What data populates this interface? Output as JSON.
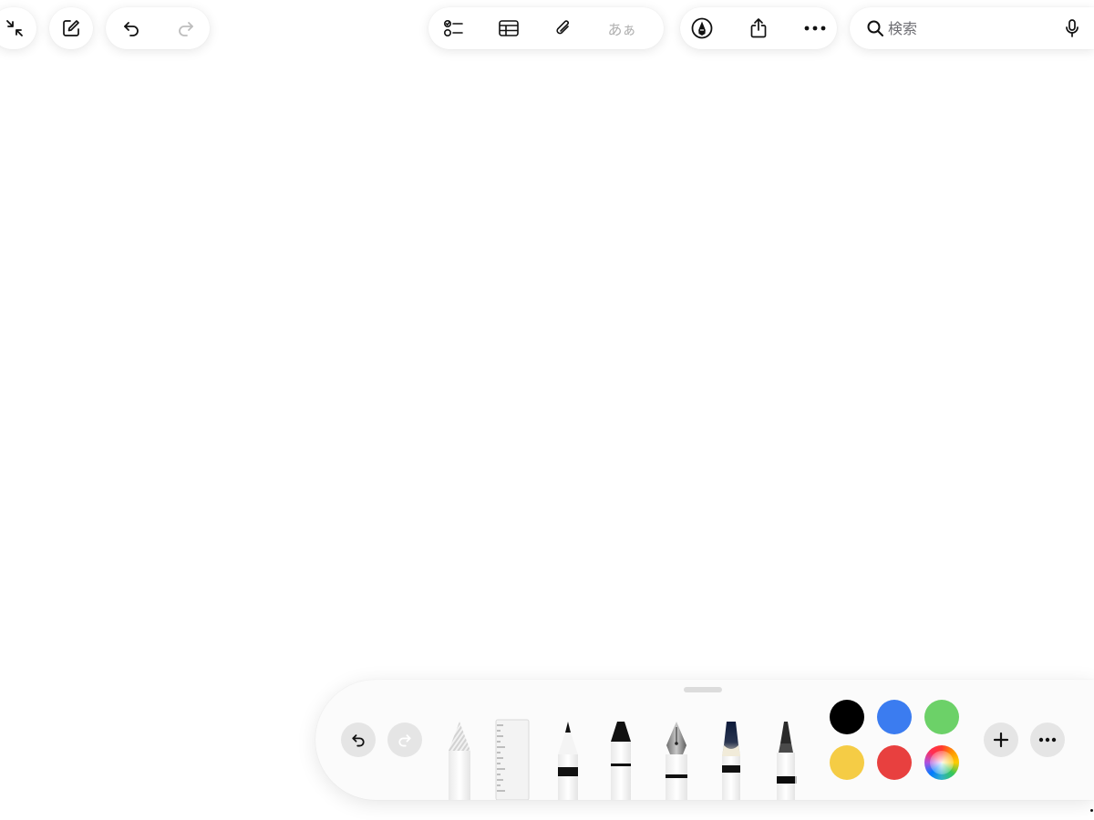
{
  "toolbar": {
    "left_buttons": [
      "collapse-icon",
      "compose-icon"
    ],
    "history_buttons": [
      "undo-icon",
      "redo-icon"
    ],
    "format_buttons": [
      "checklist-icon",
      "table-icon",
      "attachment-icon",
      "text-style-button"
    ],
    "text_style_label": "あぁ",
    "markup_buttons": [
      "markup-pen-icon",
      "share-icon",
      "more-icon"
    ]
  },
  "search": {
    "placeholder": "検索",
    "value": "",
    "mic_icon": "microphone-icon"
  },
  "palette": {
    "history_buttons": [
      "undo-icon",
      "redo-icon"
    ],
    "tools": [
      "eraser",
      "ruler",
      "pencil-monoline",
      "marker",
      "fountain-pen",
      "watercolor-brush",
      "crayon"
    ],
    "colors": [
      "#000000",
      "#3b7cf0",
      "#6cd168",
      "#f5cc45",
      "#e8403f",
      "multicolor-picker"
    ],
    "add_button": "plus-icon",
    "more_button": "more-icon"
  }
}
